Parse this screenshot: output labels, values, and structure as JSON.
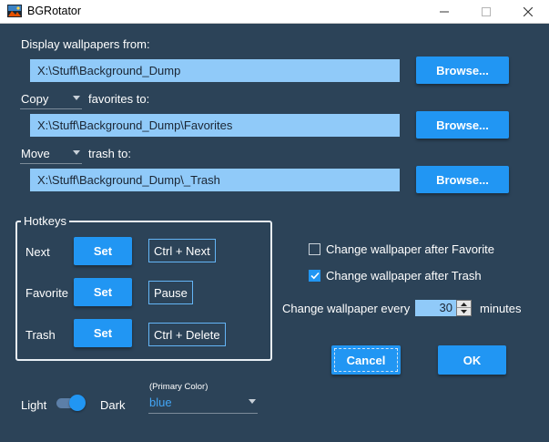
{
  "window": {
    "title": "BGRotator"
  },
  "display": {
    "label": "Display wallpapers from:",
    "path": "X:\\Stuff\\Background_Dump",
    "browse": "Browse..."
  },
  "favorites": {
    "mode": "Copy",
    "label": "favorites to:",
    "path": "X:\\Stuff\\Background_Dump\\Favorites",
    "browse": "Browse..."
  },
  "trash": {
    "mode": "Move",
    "label": "trash to:",
    "path": "X:\\Stuff\\Background_Dump\\_Trash",
    "browse": "Browse..."
  },
  "hotkeys": {
    "title": "Hotkeys",
    "rows": [
      {
        "name": "Next",
        "button": "Set",
        "value": "Ctrl + Next"
      },
      {
        "name": "Favorite",
        "button": "Set",
        "value": "Pause"
      },
      {
        "name": "Trash",
        "button": "Set",
        "value": "Ctrl + Delete"
      }
    ]
  },
  "options": {
    "after_favorite": {
      "label": "Change wallpaper after Favorite",
      "checked": false
    },
    "after_trash": {
      "label": "Change wallpaper after Trash",
      "checked": true
    },
    "interval": {
      "label": "Change wallpaper every",
      "value": "30",
      "unit": "minutes"
    }
  },
  "actions": {
    "cancel": "Cancel",
    "ok": "OK"
  },
  "theme": {
    "light": "Light",
    "dark": "Dark",
    "dark_enabled": true,
    "primary_label": "(Primary Color)",
    "primary_value": "blue"
  },
  "colors": {
    "background": "#2c4358",
    "accent": "#2196f3",
    "input_fill": "#90caf9",
    "link_text": "#42a5f5"
  }
}
